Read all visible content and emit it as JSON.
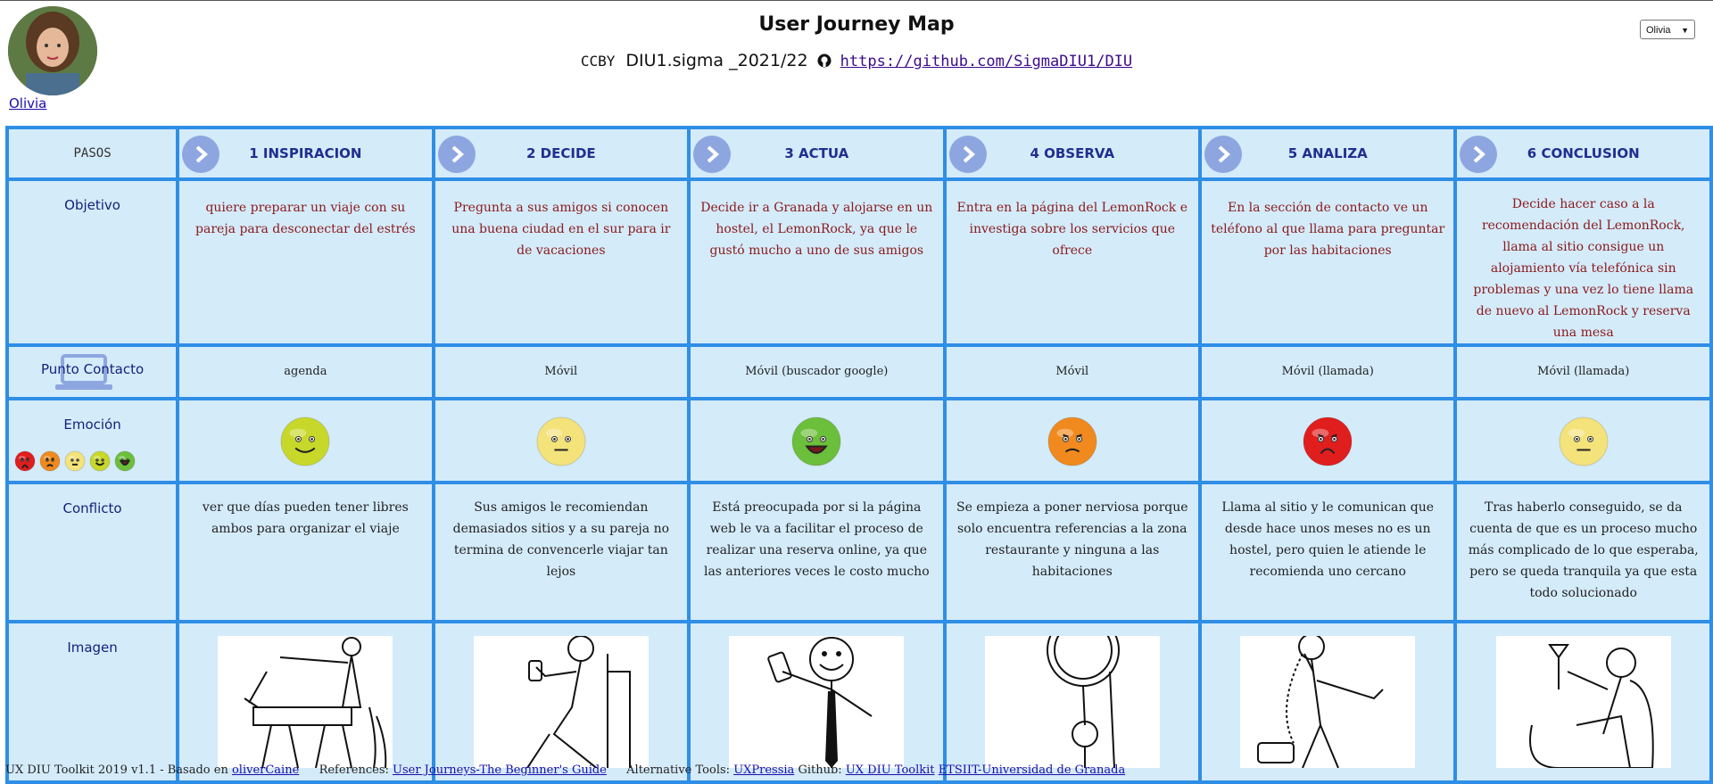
{
  "persona": {
    "name": "Olivia"
  },
  "header": {
    "title": "User Journey Map",
    "license": "CCBY",
    "project": "DIU1.sigma _2021/22",
    "repo_link": "https://github.com/SigmaDIU1/DIU"
  },
  "persona_select": {
    "selected": "Olivia"
  },
  "rows": {
    "pasos": "PASOS",
    "objetivo": "Objetivo",
    "contacto": "Punto Contacto",
    "emocion": "Emoción",
    "conflicto": "Conflicto",
    "imagen": "Imagen"
  },
  "steps": [
    {
      "title": "1 INSPIRACION",
      "objetivo": "quiere preparar un viaje con su pareja para desconectar del estrés",
      "contacto": "agenda",
      "emotion": "happy",
      "emotion_color": "#c8d82a",
      "conflicto": "ver que días pueden tener libres ambos para organizar el viaje"
    },
    {
      "title": "2 DECIDE",
      "objetivo": "Pregunta a sus amigos si conocen una buena ciudad en el sur para ir de vacaciones",
      "contacto": "Móvil",
      "emotion": "neutral",
      "emotion_color": "#f4e27a",
      "conflicto": "Sus amigos le recomiendan demasiados sitios y a su pareja no termina de convencerle viajar tan lejos"
    },
    {
      "title": "3 ACTUA",
      "objetivo": "Decide ir a Granada y alojarse en un hostel, el LemonRock, ya que le gustó mucho a uno de sus amigos",
      "contacto": "Móvil (buscador google)",
      "emotion": "very-happy",
      "emotion_color": "#6cbf3a",
      "conflicto": "Está preocupada por si la página web le va a facilitar el proceso de realizar una reserva online, ya que las anteriores veces le costo mucho"
    },
    {
      "title": "4 OBSERVA",
      "objetivo": "Entra en la página del LemonRock e investiga sobre los servicios que ofrece",
      "contacto": "Móvil",
      "emotion": "annoyed",
      "emotion_color": "#f08a1e",
      "conflicto": "Se empieza a poner nerviosa porque solo encuentra referencias a la zona restaurante y ninguna a las habitaciones"
    },
    {
      "title": "5 ANALIZA",
      "objetivo": "En la sección de contacto ve un teléfono al que llama para preguntar por las habitaciones",
      "contacto": "Móvil (llamada)",
      "emotion": "angry",
      "emotion_color": "#e01e1e",
      "conflicto": "Llama al sitio y le comunican que desde hace unos meses no es un hostel, pero quien le atiende le recomienda uno cercano"
    },
    {
      "title": "6 CONCLUSION",
      "objetivo": "Decide hacer caso a la recomendación del LemonRock, llama al sitio consigue un alojamiento vía telefónica sin problemas y una vez lo tiene llama de nuevo al LemonRock y reserva una mesa",
      "contacto": "Móvil (llamada)",
      "emotion": "neutral",
      "emotion_color": "#f4e27a",
      "conflicto": "Tras haberlo conseguido, se da cuenta de que es un proceso mucho más complicado de lo que esperaba, pero se queda tranquila ya que esta todo solucionado"
    }
  ],
  "emotion_scale": [
    "#e01e1e",
    "#f08a1e",
    "#f4e27a",
    "#c8d82a",
    "#6cbf3a"
  ],
  "footer": {
    "toolkit": "UX DIU Toolkit 2019 v1.1 - Basado en",
    "based_on_link": "oliverCaine",
    "references_label": "References:",
    "references_link": "User Journeys-The Beginner's Guide",
    "alt_label": "Alternative Tools:",
    "alt_link": "UXPressia",
    "github_label": "Github:",
    "github_link": "UX DIU Toolkit",
    "etsiit_link": "ETSIIT-Universidad de Granada"
  }
}
